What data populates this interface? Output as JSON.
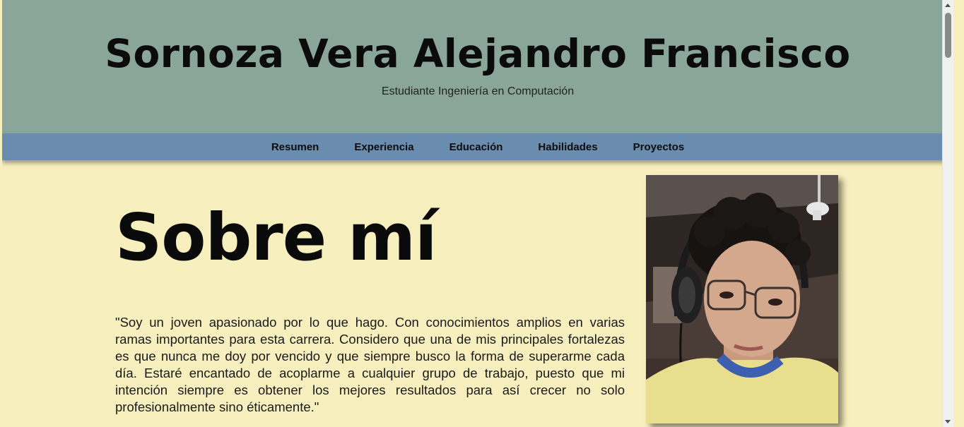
{
  "header": {
    "name": "Sornoza Vera Alejandro Francisco",
    "subtitle": "Estudiante Ingeniería en Computación"
  },
  "nav": {
    "items": [
      "Resumen",
      "Experiencia",
      "Educación",
      "Habilidades",
      "Proyectos"
    ]
  },
  "about": {
    "title": "Sobre mí",
    "text": "\"Soy un joven apasionado por lo que hago. Con conocimientos amplios en varias ramas importantes para esta carrera. Considero que una de mis principales fortalezas es que nunca me doy por vencido y que siempre busco la forma de superarme cada día. Estaré encantado de acoplarme a cualquier grupo de trabajo, puesto que mi intención siempre es obtener los mejores resultados para así crecer no solo profesionalmente sino éticamente.\""
  },
  "colors": {
    "header_bg": "#8aa69b",
    "nav_bg": "#6a8caf",
    "page_bg": "#f7efbd"
  }
}
